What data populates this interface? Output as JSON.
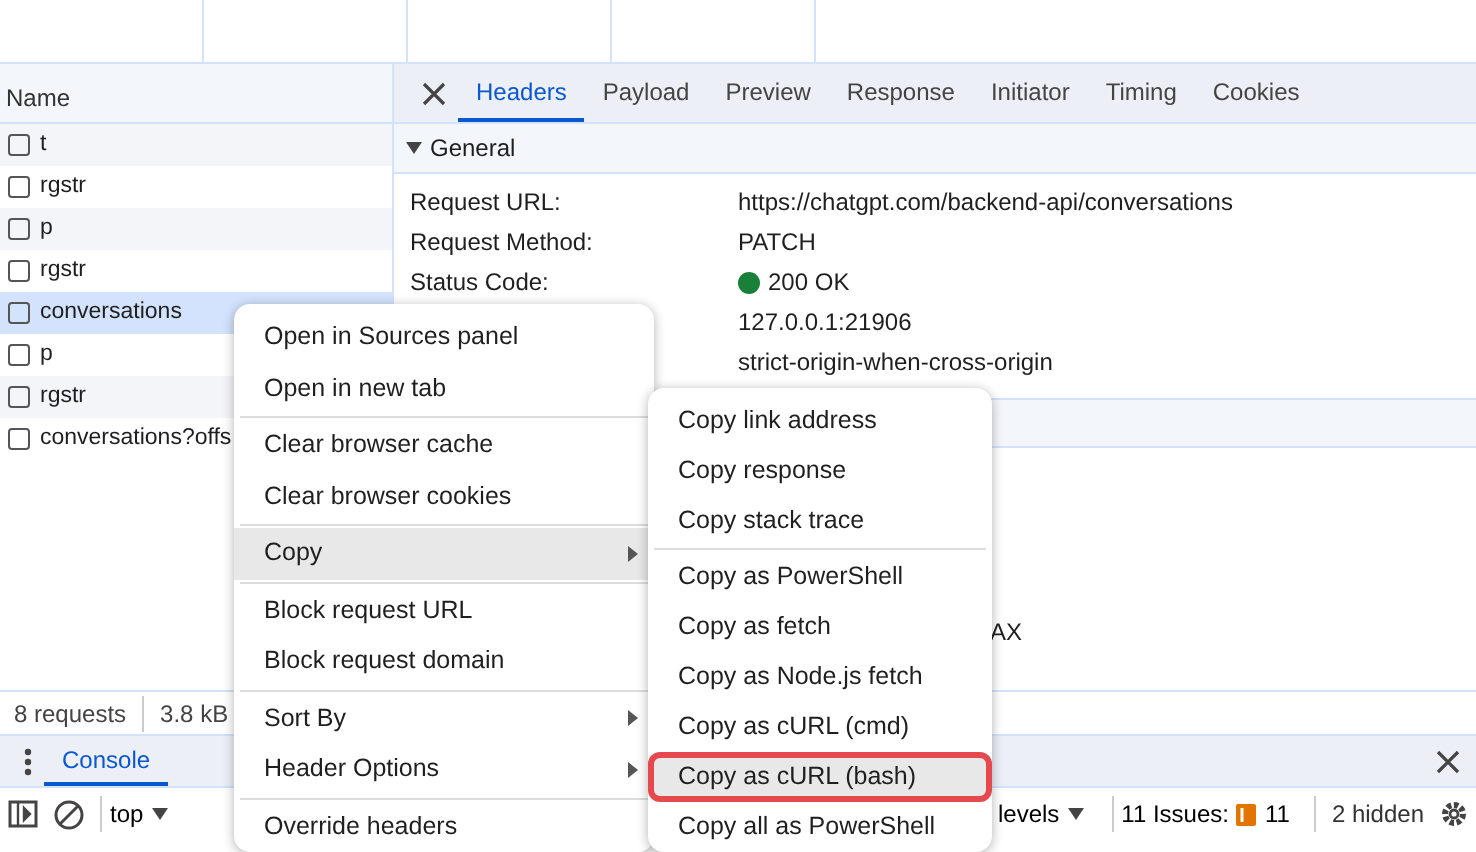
{
  "request_list": {
    "header": "Name",
    "rows": [
      {
        "name": "t",
        "selected": false
      },
      {
        "name": "rgstr",
        "selected": false
      },
      {
        "name": "p",
        "selected": false
      },
      {
        "name": "rgstr",
        "selected": false
      },
      {
        "name": "conversations",
        "selected": true
      },
      {
        "name": "p",
        "selected": false
      },
      {
        "name": "rgstr",
        "selected": false
      },
      {
        "name": "conversations?offs",
        "selected": false
      }
    ]
  },
  "details": {
    "tabs": [
      {
        "label": "Headers",
        "selected": true
      },
      {
        "label": "Payload",
        "selected": false
      },
      {
        "label": "Preview",
        "selected": false
      },
      {
        "label": "Response",
        "selected": false
      },
      {
        "label": "Initiator",
        "selected": false
      },
      {
        "label": "Timing",
        "selected": false
      },
      {
        "label": "Cookies",
        "selected": false
      }
    ],
    "general": {
      "title": "General",
      "expanded": true,
      "rows": [
        {
          "label": "Request URL:",
          "value": "https://chatgpt.com/backend-api/conversations",
          "kind": "text"
        },
        {
          "label": "Request Method:",
          "value": "PATCH",
          "kind": "text"
        },
        {
          "label": "Status Code:",
          "value": "200 OK",
          "kind": "status",
          "color": "#188038"
        },
        {
          "label": "",
          "value": "127.0.0.1:21906",
          "kind": "text"
        },
        {
          "label": "",
          "value": "strict-origin-when-cross-origin",
          "kind": "text"
        }
      ]
    },
    "fragment": "AX"
  },
  "status_bar": {
    "requests": "8 requests",
    "transferred": "3.8 kB"
  },
  "drawer": {
    "tabs": [
      {
        "label": "Console",
        "selected": true
      }
    ],
    "context": "top",
    "levels": "levels",
    "issues": "11 Issues:",
    "issue_count": "11",
    "hidden": "2 hidden"
  },
  "context_menu": {
    "groups": [
      [
        {
          "label": "Open in Sources panel",
          "submenu": false,
          "highlighted": false
        },
        {
          "label": "Open in new tab",
          "submenu": false,
          "highlighted": false
        }
      ],
      [
        {
          "label": "Clear browser cache",
          "submenu": false,
          "highlighted": false
        },
        {
          "label": "Clear browser cookies",
          "submenu": false,
          "highlighted": false
        }
      ],
      [
        {
          "label": "Copy",
          "submenu": true,
          "highlighted": true
        }
      ],
      [
        {
          "label": "Block request URL",
          "submenu": false,
          "highlighted": false
        },
        {
          "label": "Block request domain",
          "submenu": false,
          "highlighted": false
        }
      ],
      [
        {
          "label": "Sort By",
          "submenu": true,
          "highlighted": false
        },
        {
          "label": "Header Options",
          "submenu": true,
          "highlighted": false
        }
      ],
      [
        {
          "label": "Override headers",
          "submenu": false,
          "highlighted": false
        }
      ]
    ]
  },
  "copy_submenu": {
    "groups": [
      [
        {
          "label": "Copy link address",
          "highlighted": false,
          "outlined": false
        },
        {
          "label": "Copy response",
          "highlighted": false,
          "outlined": false
        },
        {
          "label": "Copy stack trace",
          "highlighted": false,
          "outlined": false
        }
      ],
      [
        {
          "label": "Copy as PowerShell",
          "highlighted": false,
          "outlined": false
        },
        {
          "label": "Copy as fetch",
          "highlighted": false,
          "outlined": false
        },
        {
          "label": "Copy as Node.js fetch",
          "highlighted": false,
          "outlined": false
        },
        {
          "label": "Copy as cURL (cmd)",
          "highlighted": false,
          "outlined": false
        },
        {
          "label": "Copy as cURL (bash)",
          "highlighted": true,
          "outlined": true
        },
        {
          "label": "Copy all as PowerShell",
          "highlighted": false,
          "outlined": false
        }
      ]
    ]
  }
}
